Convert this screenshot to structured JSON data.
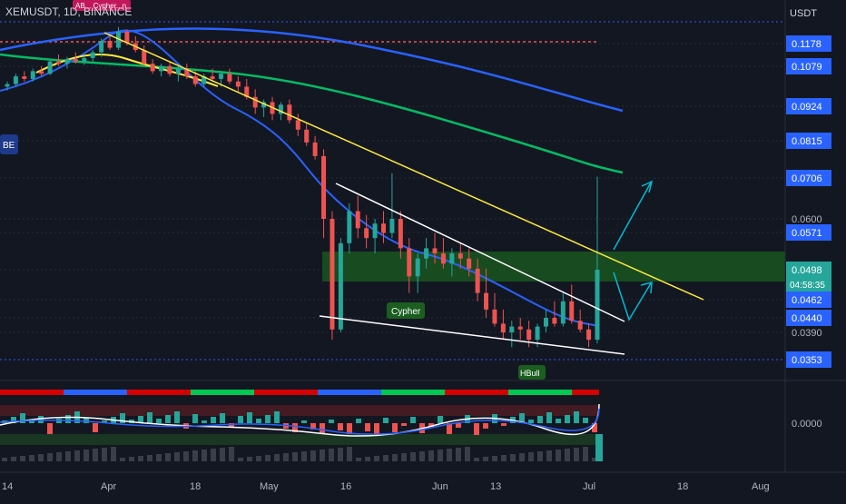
{
  "header": {
    "symbol_line": "XEMUSDT, 1D, BINANCE",
    "currency": "USDT",
    "top_badge": "AB... Cypher...n"
  },
  "chart_data": {
    "type": "candlestick",
    "symbol": "XEMUSDT",
    "interval": "1D",
    "exchange": "BINANCE",
    "y_ticks": [
      "0.1178",
      "0.1079",
      "0.0924",
      "0.0815",
      "0.0706",
      "0.0600",
      "0.0571",
      "0.0498",
      "0.0462",
      "0.0440",
      "0.0390",
      "0.0353"
    ],
    "highlighted_prices": [
      {
        "label": "0.1178",
        "color": "#2962ff"
      },
      {
        "label": "0.1079",
        "color": "#2962ff"
      },
      {
        "label": "0.0924",
        "color": "#2962ff"
      },
      {
        "label": "0.0815",
        "color": "#2962ff"
      },
      {
        "label": "0.0706",
        "color": "#2962ff"
      },
      {
        "label": "0.0571",
        "color": "#2962ff"
      },
      {
        "label": "0.0498",
        "color": "#26a69a"
      },
      {
        "label": "0.0462",
        "color": "#2962ff"
      },
      {
        "label": "0.0440",
        "color": "#2962ff"
      },
      {
        "label": "0.0353",
        "color": "#2962ff"
      }
    ],
    "plain_prices": [
      "0.0600",
      "0.0390"
    ],
    "countdown": "04:58:35",
    "x_ticks": [
      "14",
      "Apr",
      "18",
      "May",
      "16",
      "Jun",
      "13",
      "Jul",
      "18",
      "Aug"
    ],
    "indicator_value": "0.0000",
    "annotations": [
      "BE",
      "Cypher",
      "Cypher",
      "HBull"
    ],
    "colors": {
      "up": "#26a69a",
      "down": "#ef5350",
      "bull_zone": "#1b5e20",
      "trendline": "#ffeb3b",
      "wedge": "#ffffff",
      "arrow": "#00bcd4"
    },
    "candles": [
      [
        0.1,
        0.102,
        0.0985,
        0.101
      ],
      [
        0.101,
        0.105,
        0.1,
        0.104
      ],
      [
        0.104,
        0.106,
        0.102,
        0.103
      ],
      [
        0.103,
        0.107,
        0.102,
        0.106
      ],
      [
        0.106,
        0.108,
        0.104,
        0.105
      ],
      [
        0.105,
        0.111,
        0.1045,
        0.11
      ],
      [
        0.11,
        0.113,
        0.108,
        0.109
      ],
      [
        0.109,
        0.112,
        0.107,
        0.111
      ],
      [
        0.111,
        0.114,
        0.109,
        0.11
      ],
      [
        0.11,
        0.1125,
        0.1085,
        0.1115
      ],
      [
        0.1115,
        0.115,
        0.11,
        0.114
      ],
      [
        0.114,
        0.12,
        0.112,
        0.119
      ],
      [
        0.119,
        0.122,
        0.115,
        0.116
      ],
      [
        0.116,
        0.125,
        0.115,
        0.123
      ],
      [
        0.123,
        0.124,
        0.117,
        0.118
      ],
      [
        0.118,
        0.121,
        0.114,
        0.115
      ],
      [
        0.115,
        0.117,
        0.108,
        0.109
      ],
      [
        0.109,
        0.111,
        0.105,
        0.106
      ],
      [
        0.106,
        0.109,
        0.104,
        0.108
      ],
      [
        0.108,
        0.11,
        0.104,
        0.105
      ],
      [
        0.105,
        0.108,
        0.102,
        0.107
      ],
      [
        0.107,
        0.109,
        0.103,
        0.104
      ],
      [
        0.104,
        0.106,
        0.1,
        0.101
      ],
      [
        0.101,
        0.105,
        0.1,
        0.104
      ],
      [
        0.104,
        0.107,
        0.102,
        0.103
      ],
      [
        0.103,
        0.106,
        0.1,
        0.105
      ],
      [
        0.105,
        0.107,
        0.101,
        0.102
      ],
      [
        0.102,
        0.104,
        0.098,
        0.1
      ],
      [
        0.1,
        0.103,
        0.095,
        0.096
      ],
      [
        0.096,
        0.099,
        0.09,
        0.092
      ],
      [
        0.092,
        0.095,
        0.089,
        0.094
      ],
      [
        0.094,
        0.096,
        0.088,
        0.09
      ],
      [
        0.09,
        0.094,
        0.088,
        0.093
      ],
      [
        0.093,
        0.095,
        0.087,
        0.088
      ],
      [
        0.088,
        0.09,
        0.083,
        0.085
      ],
      [
        0.085,
        0.087,
        0.08,
        0.081
      ],
      [
        0.081,
        0.083,
        0.076,
        0.077
      ],
      [
        0.077,
        0.079,
        0.056,
        0.06
      ],
      [
        0.06,
        0.062,
        0.038,
        0.04
      ],
      [
        0.04,
        0.056,
        0.039,
        0.055
      ],
      [
        0.055,
        0.064,
        0.053,
        0.062
      ],
      [
        0.062,
        0.066,
        0.056,
        0.058
      ],
      [
        0.058,
        0.061,
        0.054,
        0.056
      ],
      [
        0.056,
        0.06,
        0.053,
        0.059
      ],
      [
        0.059,
        0.062,
        0.055,
        0.057
      ],
      [
        0.057,
        0.072,
        0.056,
        0.06
      ],
      [
        0.06,
        0.062,
        0.052,
        0.054
      ],
      [
        0.054,
        0.056,
        0.047,
        0.049
      ],
      [
        0.049,
        0.053,
        0.047,
        0.052
      ],
      [
        0.052,
        0.056,
        0.05,
        0.054
      ],
      [
        0.054,
        0.057,
        0.051,
        0.053
      ],
      [
        0.053,
        0.056,
        0.05,
        0.051
      ],
      [
        0.051,
        0.054,
        0.049,
        0.053
      ],
      [
        0.053,
        0.055,
        0.05,
        0.052
      ],
      [
        0.052,
        0.054,
        0.049,
        0.05
      ],
      [
        0.05,
        0.052,
        0.046,
        0.047
      ],
      [
        0.047,
        0.05,
        0.044,
        0.045
      ],
      [
        0.045,
        0.047,
        0.041,
        0.042
      ],
      [
        0.042,
        0.045,
        0.038,
        0.039
      ],
      [
        0.039,
        0.043,
        0.037,
        0.041
      ],
      [
        0.041,
        0.044,
        0.038,
        0.04
      ],
      [
        0.04,
        0.043,
        0.037,
        0.038
      ],
      [
        0.038,
        0.042,
        0.037,
        0.041
      ],
      [
        0.041,
        0.045,
        0.039,
        0.044
      ],
      [
        0.044,
        0.046,
        0.041,
        0.042
      ],
      [
        0.042,
        0.047,
        0.041,
        0.046
      ],
      [
        0.046,
        0.048,
        0.042,
        0.043
      ],
      [
        0.043,
        0.045,
        0.039,
        0.04
      ],
      [
        0.04,
        0.042,
        0.037,
        0.038
      ],
      [
        0.038,
        0.071,
        0.0375,
        0.0498
      ]
    ]
  }
}
